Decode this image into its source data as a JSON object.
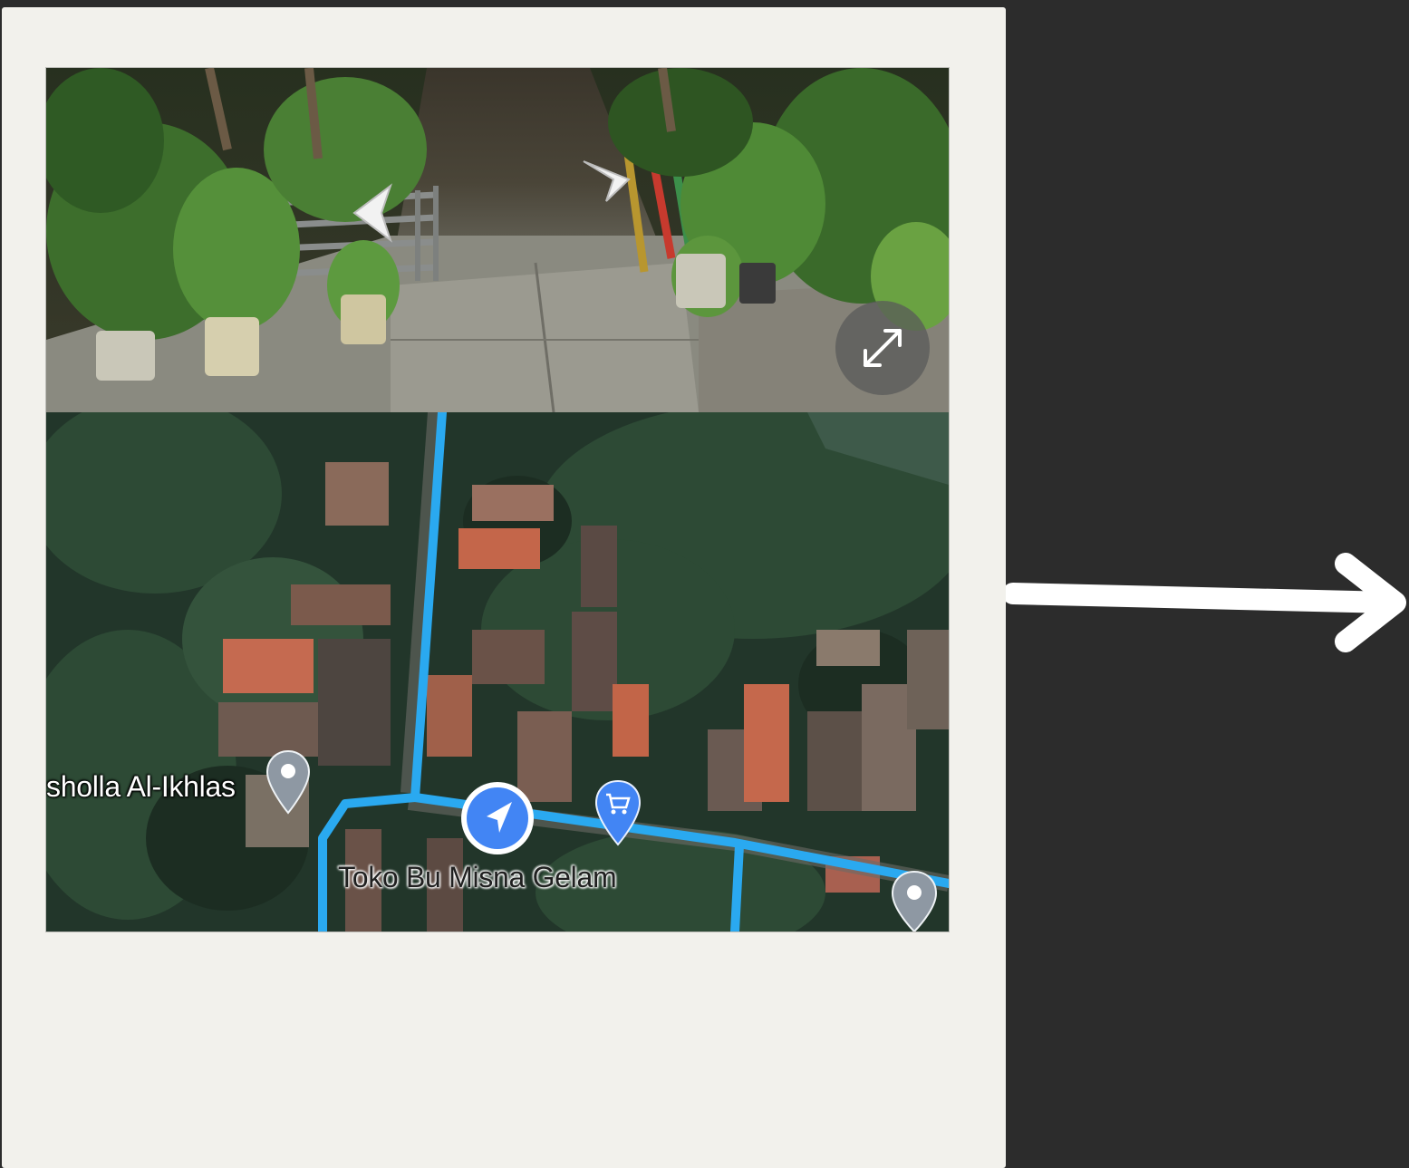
{
  "colors": {
    "background": "#2c2c2c",
    "card": "#f2f1ec",
    "route": "#2aa9f0",
    "marker": "#4285f4",
    "arrow": "#ffffff"
  },
  "street_view": {
    "prev_icon": "chevron-left-icon",
    "next_icon": "chevron-right-icon",
    "expand_icon": "expand-arrows-icon"
  },
  "map": {
    "places": [
      {
        "label": "sholla Al-Ikhlas",
        "icon": "map-pin-icon"
      },
      {
        "label": "Toko Bu Misna Gelam",
        "icon": "shopping-cart-pin-icon"
      }
    ],
    "location_icon": "navigation-arrow-icon",
    "extra_pin_icon": "map-pin-icon"
  },
  "pointer": {
    "icon": "right-arrow-icon"
  }
}
